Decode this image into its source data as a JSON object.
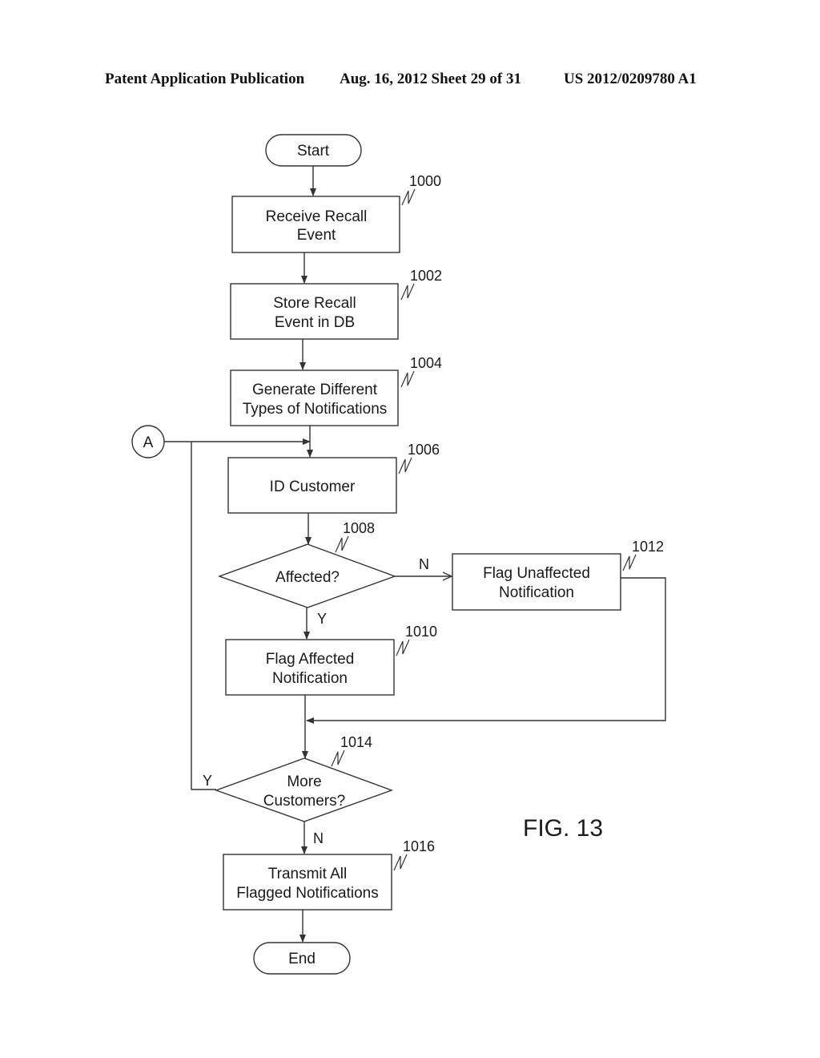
{
  "header": {
    "publication": "Patent Application Publication",
    "date_sheet": "Aug. 16, 2012  Sheet 29 of 31",
    "number": "US 2012/0209780 A1"
  },
  "figure_label": "FIG. 13",
  "connector": {
    "label": "A"
  },
  "nodes": {
    "start": {
      "label": "Start"
    },
    "receive": {
      "ref": "1000",
      "lines": [
        "Receive Recall",
        "Event"
      ]
    },
    "store": {
      "ref": "1002",
      "lines": [
        "Store Recall",
        "Event in DB"
      ]
    },
    "generate": {
      "ref": "1004",
      "lines": [
        "Generate Different",
        "Types of Notifications"
      ]
    },
    "id_customer": {
      "ref": "1006",
      "lines": [
        "ID Customer"
      ]
    },
    "affected": {
      "ref": "1008",
      "lines": [
        "Affected?"
      ]
    },
    "flag_affected": {
      "ref": "1010",
      "lines": [
        "Flag Affected",
        "Notification"
      ]
    },
    "flag_unaffected": {
      "ref": "1012",
      "lines": [
        "Flag Unaffected",
        "Notification"
      ]
    },
    "more": {
      "ref": "1014",
      "lines": [
        "More",
        "Customers?"
      ]
    },
    "transmit": {
      "ref": "1016",
      "lines": [
        "Transmit All",
        "Flagged Notifications"
      ]
    },
    "end": {
      "label": "End"
    }
  },
  "branches": {
    "affected_no": "N",
    "affected_yes": "Y",
    "more_yes": "Y",
    "more_no": "N"
  }
}
